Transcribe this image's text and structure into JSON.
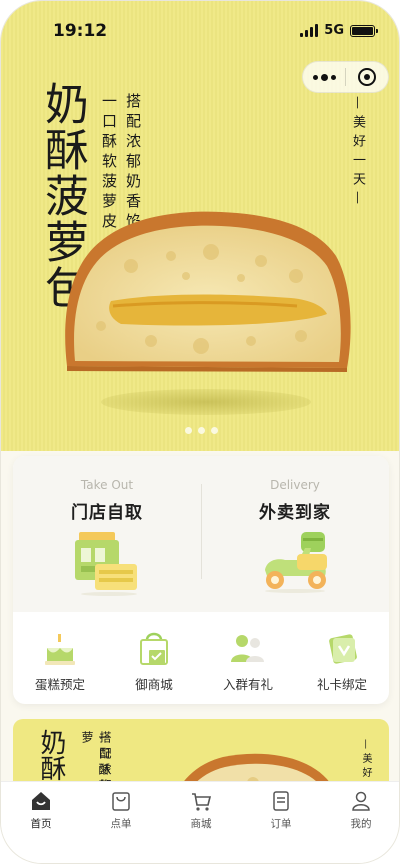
{
  "status_bar": {
    "time": "19:12",
    "network": "5G"
  },
  "banner": {
    "title": "奶酥菠萝包",
    "subtitle_line1": "一口酥软菠萝皮",
    "subtitle_line2": "搭配浓郁奶香馅",
    "side_tag": "—美好一天—",
    "dots_count": 3,
    "background": "#efe882"
  },
  "services": {
    "pickup": {
      "en": "Take Out",
      "cn": "门店自取"
    },
    "delivery": {
      "en": "Delivery",
      "cn": "外卖到家"
    }
  },
  "quick_links": [
    {
      "label": "蛋糕预定",
      "icon": "cake-icon"
    },
    {
      "label": "御商城",
      "icon": "shopping-bag-icon"
    },
    {
      "label": "入群有礼",
      "icon": "group-users-icon"
    },
    {
      "label": "礼卡绑定",
      "icon": "gift-card-icon"
    }
  ],
  "banner2": {
    "title": "奶酥",
    "subtitle_line1": "一口酥软菠萝",
    "subtitle_line2": "搭配浓郁奶",
    "side_tag": "—美好一"
  },
  "tabbar": [
    {
      "label": "首页",
      "icon": "home-icon",
      "active": true
    },
    {
      "label": "点单",
      "icon": "order-bag-icon",
      "active": false
    },
    {
      "label": "商城",
      "icon": "cart-icon",
      "active": false
    },
    {
      "label": "订单",
      "icon": "receipt-icon",
      "active": false
    },
    {
      "label": "我的",
      "icon": "profile-icon",
      "active": false
    }
  ],
  "colors": {
    "accent": "#efe882",
    "pickup_green": "#b6d86a",
    "delivery_green": "#9ed15c",
    "text_dark": "#1f1f1f"
  }
}
